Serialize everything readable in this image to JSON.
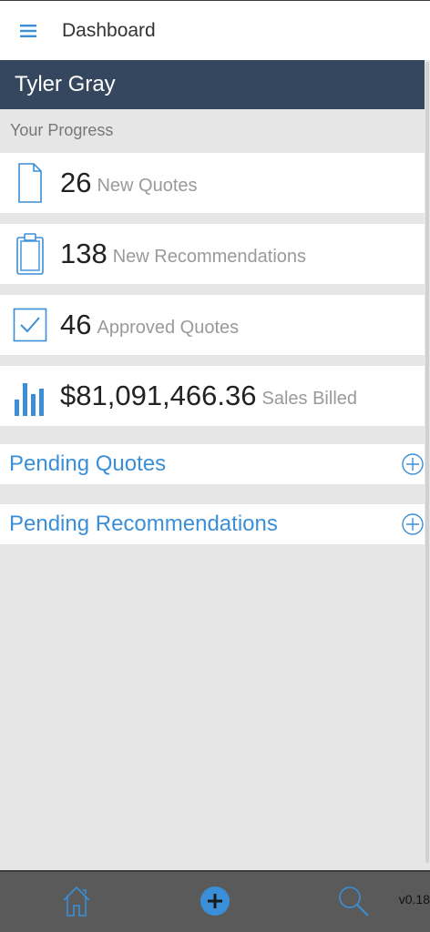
{
  "header": {
    "menu_icon": "hamburger-menu-icon",
    "title": "Dashboard"
  },
  "user": {
    "name": "Tyler Gray"
  },
  "progress": {
    "label": "Your Progress",
    "stats": [
      {
        "icon": "document-icon",
        "value": "26",
        "label": "New Quotes"
      },
      {
        "icon": "clipboard-icon",
        "value": "138",
        "label": "New Recommendations"
      },
      {
        "icon": "checkbox-icon",
        "value": "46",
        "label": "Approved Quotes"
      },
      {
        "icon": "bar-chart-icon",
        "value": "$81,091,466.36",
        "label": "Sales Billed"
      }
    ]
  },
  "pending": [
    {
      "label": "Pending Quotes",
      "icon": "plus-circle-icon"
    },
    {
      "label": "Pending Recommendations",
      "icon": "plus-circle-icon"
    }
  ],
  "bottom_nav": {
    "items": [
      "home-icon",
      "add-circle-icon",
      "search-icon"
    ],
    "version": "v0.18"
  },
  "colors": {
    "accent": "#3a8fd8",
    "user_bar": "#34475e",
    "bottom_bar": "#5a5a5a",
    "background": "#e6e6e6"
  }
}
